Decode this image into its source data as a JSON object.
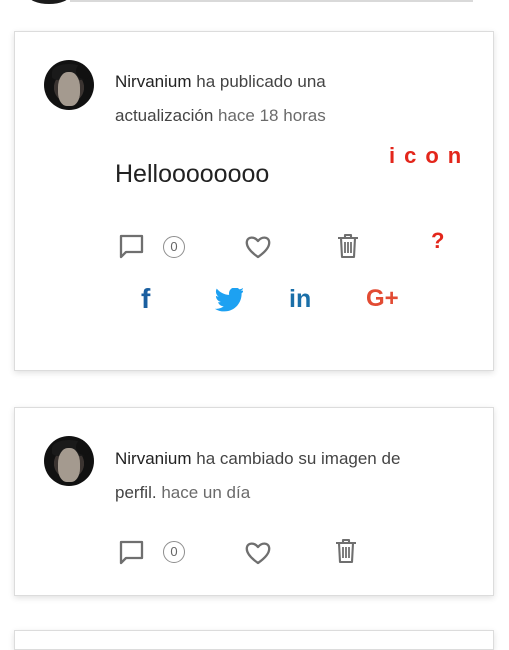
{
  "posts": [
    {
      "username": "Nirvanium",
      "action": "ha publicado una actualización",
      "time": "hace 18 horas",
      "content": "Helloooooooo",
      "comment_count": "0"
    },
    {
      "username": "Nirvanium",
      "action": "ha cambiado su imagen de perfil.",
      "time": "hace un día",
      "comment_count": "0"
    }
  ],
  "brand_mark": "icon",
  "help_mark": "?",
  "share": {
    "facebook_glyph": "f",
    "linkedin_glyph": "in",
    "google_plus_glyph": "G+"
  },
  "colors": {
    "accent_red": "#e3261b",
    "facebook": "#1a5fa0",
    "twitter": "#1da1f2",
    "linkedin": "#1a6fa8",
    "google_plus": "#e24b33",
    "icon_gray": "#6f6f6f"
  },
  "icons": [
    "comment-icon",
    "heart-icon",
    "trash-icon",
    "question-icon",
    "facebook-icon",
    "twitter-icon",
    "linkedin-icon",
    "google-plus-icon"
  ]
}
